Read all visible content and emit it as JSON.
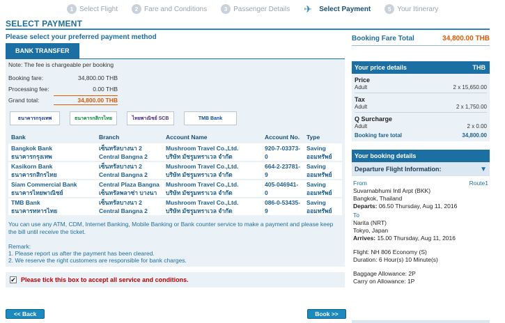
{
  "steps": [
    {
      "num": "1",
      "label": "Select Flight"
    },
    {
      "num": "2",
      "label": "Fare and Conditions"
    },
    {
      "num": "3",
      "label": "Passenger Details"
    },
    {
      "num": "",
      "label": "Select Payment"
    },
    {
      "num": "5",
      "label": "Your Itinerary"
    }
  ],
  "section_title": "SELECT PAYMENT",
  "prompt": "Please select your preferred payment method",
  "tab_label": "BANK TRANSFER",
  "note": "Note: The fee is chargeable per booking",
  "fees": {
    "booking_label": "Booking fare:",
    "booking_value": "34,800.00 THB",
    "processing_label": "Processing fee:",
    "processing_value": "0.00 THB",
    "grand_label": "Grand total:",
    "grand_value": "34,800.00 THB"
  },
  "logos": {
    "bbl": "ธนาคารกรุงเทพ",
    "kbank": "ธนาคารกสิกรไทย",
    "scb": "ไทยพาณิชย์ SCB",
    "tmb": "TMB Bank"
  },
  "table": {
    "headers": [
      "Bank",
      "Branch",
      "Account Name",
      "Account No.",
      "Type"
    ],
    "rows": [
      {
        "bank_en": "Bangkok Bank",
        "bank_th": "ธนาคารกรุงเทพ",
        "branch_th": "เซ็นทรัลบางนา 2",
        "branch_en": "Central Bangna 2",
        "name_en": "Mushroom Travel Co.,Ltd.",
        "name_th": "บริษัท มัชรูมทราเวล จำกัด",
        "acc": "920-7-03373-0",
        "type_en": "Saving",
        "type_th": "ออมทรัพย์"
      },
      {
        "bank_en": "Kasikorn Bank",
        "bank_th": "ธนาคารกสิกรไทย",
        "branch_th": "เซ็นทรัลบางนา 2",
        "branch_en": "Central Bangna 2",
        "name_en": "Mushroom Travel Co.,Ltd.",
        "name_th": "บริษัท มัชรูมทราเวล จำกัด",
        "acc": "664-2-23781-9",
        "type_en": "Saving",
        "type_th": "ออมทรัพย์"
      },
      {
        "bank_en": "Siam Commercial Bank",
        "bank_th": "ธนาคารไทยพาณิชย์",
        "branch_th": "Central Plaza Bangna",
        "branch_en": "เซ็นทรัลพลาซ่า บางนา",
        "name_en": "Mushroom Travel Co.,Ltd.",
        "name_th": "บริษัท มัชรูมทราเวล จำกัด",
        "acc": "405-046941-0",
        "type_en": "Saving",
        "type_th": "ออมทรัพย์"
      },
      {
        "bank_en": "TMB Bank",
        "bank_th": "ธนาคารทหารไทย",
        "branch_th": "เซ็นทรัลบางนา 2",
        "branch_en": "Central Bangna 2",
        "name_en": "Mushroom Travel Co.,Ltd.",
        "name_th": "บริษัท มัชรูมทราเวล จำกัด",
        "acc": "086-0-53435-9",
        "type_en": "Saving",
        "type_th": "ออมทรัพย์"
      }
    ]
  },
  "info": "You can use any ATM, CDM, Internet Banking, Mobile Banking or Bank counter service to make a payment and please keep the bill until receive the ticket.",
  "remark": {
    "title": "Remark:",
    "line1": "1. Please report us after the payment has been cleared.",
    "line2": "2. We reserve the right customers are responsible for bank charges."
  },
  "accept_label": "Please tick this box to accept all service and conditions.",
  "back_label": "<< Back",
  "book_label": "Book >>",
  "right": {
    "total_label": "Booking Fare Total",
    "total_value": "34,800.00 THB",
    "price_head": "Your price details",
    "currency": "THB",
    "price_title": "Price",
    "price_adult_label": "Adult",
    "price_adult_value": "2 x 15,650.00",
    "tax_title": "Tax",
    "tax_adult_label": "Adult",
    "tax_adult_value": "2 x 1,750.00",
    "q_title": "Q Surcharge",
    "q_adult_label": "Adult",
    "q_adult_value": "2 x 0.00",
    "fare_total_label": "Booking fare total",
    "fare_total_value": "34,800.00",
    "booking_head": "Your booking details",
    "dep_label": "Departure Flight Information:",
    "from_label": "From",
    "route_label": "Route1",
    "from_airport": "Suvarnabhumi Intl Arpt (BKK)",
    "from_city": "Bangkok, Thailand",
    "departs_label": "Departs:",
    "departs_value": "06.50 Thursday, Aug 11, 2016",
    "to_label": "To",
    "to_airport": "Narita (NRT)",
    "to_city": "Tokyo, Japan",
    "arrives_label": "Arrives:",
    "arrives_value": "15.00 Thursday, Aug 11, 2016",
    "flight": "Flight: NH 806 Economy (S)",
    "duration": "Duration: 6 Hour(s) 10 Minute(s)",
    "baggage": "Baggage Allowance: 2P",
    "carry": "Carry on Allowance: 1P"
  }
}
